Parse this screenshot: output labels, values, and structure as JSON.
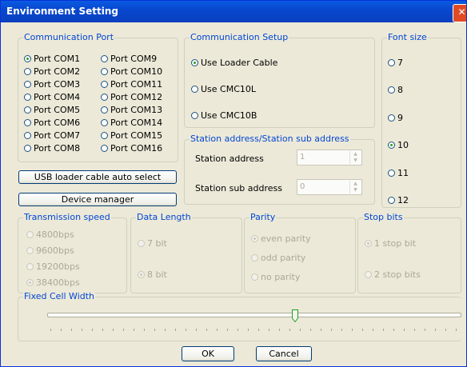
{
  "window": {
    "title": "Environment Setting"
  },
  "comm_port": {
    "legend": "Communication Port",
    "left": [
      "Port COM1",
      "Port COM2",
      "Port COM3",
      "Port COM4",
      "Port COM5",
      "Port COM6",
      "Port COM7",
      "Port COM8"
    ],
    "right": [
      "Port COM9",
      "Port COM10",
      "Port COM11",
      "Port COM12",
      "Port COM13",
      "Port COM14",
      "Port COM15",
      "Port COM16"
    ],
    "selected": "Port COM1"
  },
  "buttons": {
    "usb_auto": "USB loader cable auto select",
    "device_manager": "Device manager",
    "ok": "OK",
    "cancel": "Cancel"
  },
  "comm_setup": {
    "legend": "Communication Setup",
    "options": [
      "Use Loader Cable",
      "Use CMC10L",
      "Use CMC10B"
    ],
    "selected": "Use Loader Cable"
  },
  "station": {
    "legend": "Station address/Station sub address",
    "address_label": "Station address",
    "address_value": "1",
    "sub_label": "Station sub address",
    "sub_value": "0"
  },
  "font_size": {
    "legend": "Font size",
    "options": [
      "7",
      "8",
      "9",
      "10",
      "11",
      "12"
    ],
    "selected": "10"
  },
  "transmission": {
    "legend": "Transmission speed",
    "options": [
      "4800bps",
      "9600bps",
      "19200bps",
      "38400bps"
    ],
    "selected": "38400bps"
  },
  "data_length": {
    "legend": "Data Length",
    "options": [
      "7 bit",
      "8 bit"
    ],
    "selected": "8 bit"
  },
  "parity": {
    "legend": "Parity",
    "options": [
      "even parity",
      "odd  parity",
      "no parity"
    ],
    "selected": "even parity"
  },
  "stop_bits": {
    "legend": "Stop bits",
    "options": [
      "1 stop bit",
      "2 stop bits"
    ],
    "selected": "1 stop bit"
  },
  "cell_width": {
    "legend": "Fixed Cell Width",
    "slider_fraction": 0.6
  }
}
